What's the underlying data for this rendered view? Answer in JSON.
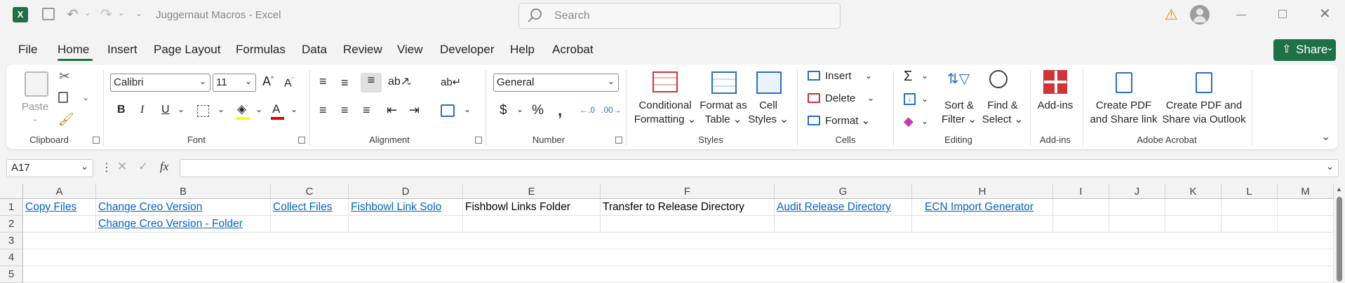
{
  "app": {
    "title": "Juggernaut Macros  -  Excel",
    "search_placeholder": "Search"
  },
  "menu": {
    "items": [
      "File",
      "Home",
      "Insert",
      "Page Layout",
      "Formulas",
      "Data",
      "Review",
      "View",
      "Developer",
      "Help",
      "Acrobat"
    ],
    "active": "Home",
    "share_label": "Share"
  },
  "ribbon": {
    "clipboard": {
      "label": "Clipboard",
      "paste": "Paste"
    },
    "font": {
      "label": "Font",
      "font_name": "Calibri",
      "font_size": "11"
    },
    "alignment": {
      "label": "Alignment"
    },
    "number": {
      "label": "Number",
      "format": "General"
    },
    "styles": {
      "label": "Styles",
      "conditional": [
        "Conditional",
        "Formatting"
      ],
      "format_table": [
        "Format as",
        "Table"
      ],
      "cell_styles": [
        "Cell",
        "Styles"
      ]
    },
    "cells": {
      "label": "Cells",
      "insert": "Insert",
      "delete": "Delete",
      "format": "Format"
    },
    "editing": {
      "label": "Editing",
      "sort": [
        "Sort &",
        "Filter"
      ],
      "find": [
        "Find &",
        "Select"
      ]
    },
    "addins": {
      "label": "Add-ins",
      "button": "Add-ins"
    },
    "acrobat": {
      "label": "Adobe Acrobat",
      "create_pdf": [
        "Create PDF",
        "and Share link"
      ],
      "create_outlook": [
        "Create PDF and",
        "Share via Outlook"
      ]
    }
  },
  "formula_bar": {
    "name_box": "A17",
    "fx": "fx",
    "value": ""
  },
  "sheet": {
    "columns": [
      "A",
      "B",
      "C",
      "D",
      "E",
      "F",
      "G",
      "H",
      "I",
      "J",
      "K",
      "L",
      "M"
    ],
    "rows": [
      "1",
      "2",
      "3",
      "4",
      "5"
    ],
    "row1": [
      "Copy Files",
      "Change Creo Version",
      "Collect Files",
      "Fishbowl Link Solo",
      "Fishbowl Links Folder",
      "Transfer to Release Directory",
      "Audit Release Directory",
      "ECN Import Generator"
    ],
    "row2_b": "Change Creo Version - Folder"
  },
  "colors": {
    "excel_green": "#1e7145",
    "link": "#0563c1"
  }
}
